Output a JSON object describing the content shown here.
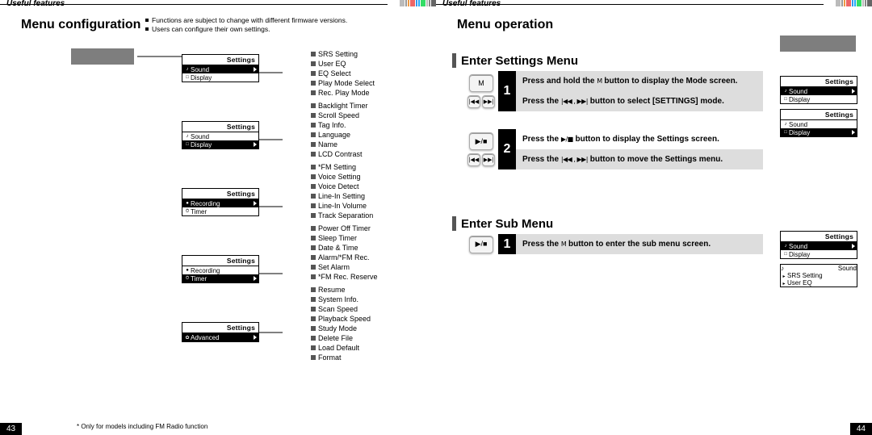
{
  "common": {
    "header_label": "Useful features",
    "settings_header": "Settings",
    "sound_header": "Sound"
  },
  "left_page": {
    "title": "Menu configuration",
    "notes": [
      "Functions are subject to change with different firmware versions.",
      "Users can configure their own settings."
    ],
    "footnote": "* Only for models including FM Radio function",
    "page_number": "43",
    "settings_column": [
      {
        "items": [
          {
            "icon": "♪",
            "label": "Sound",
            "sel": true
          },
          {
            "icon": "□",
            "label": "Display",
            "sel": false
          }
        ],
        "tree_idx": 0
      },
      {
        "items": [
          {
            "icon": "♪",
            "label": "Sound",
            "sel": false
          },
          {
            "icon": "□",
            "label": "Display",
            "sel": true
          }
        ],
        "tree_idx": 1
      },
      {
        "items": [
          {
            "icon": "●",
            "label": "Recording",
            "sel": true
          },
          {
            "icon": "⏱",
            "label": "Timer",
            "sel": false
          }
        ],
        "tree_idx": 2
      },
      {
        "items": [
          {
            "icon": "●",
            "label": "Recording",
            "sel": false
          },
          {
            "icon": "⏱",
            "label": "Timer",
            "sel": true
          }
        ],
        "tree_idx": 3
      },
      {
        "items": [
          {
            "icon": "✿",
            "label": "Advanced",
            "sel": true
          }
        ],
        "tree_idx": 4
      }
    ],
    "tree": [
      [
        "SRS Setting",
        "User EQ",
        "EQ Select",
        "Play Mode Select",
        "Rec. Play Mode"
      ],
      [
        "Backlight Timer",
        "Scroll Speed",
        "Tag Info.",
        "Language",
        "Name",
        "LCD Contrast"
      ],
      [
        "*FM Setting",
        "Voice Setting",
        "Voice Detect",
        "Line-In Setting",
        "Line-In Volume",
        "Track Separation"
      ],
      [
        "Power Off Timer",
        "Sleep Timer",
        "Date & Time",
        "Alarm/*FM Rec.",
        "Set Alarm",
        "*FM Rec. Reserve"
      ],
      [
        "Resume",
        "System Info.",
        "Scan Speed",
        "Playback Speed",
        "Study Mode",
        "Delete File",
        "Load Default",
        "Format"
      ]
    ]
  },
  "right_page": {
    "title": "Menu operation",
    "page_number": "44",
    "sections": [
      {
        "heading": "Enter Settings Menu",
        "steps": [
          {
            "num": "1",
            "keys": [
              [
                "M"
              ],
              [
                "|◀◀",
                "▶▶|"
              ]
            ],
            "lines": [
              {
                "t": "Press and hold the ",
                "sym": "M",
                "t2": " button to display the Mode screen.",
                "grey": true
              },
              {
                "t": "Press the ",
                "sym": "|◀◀ , ▶▶|",
                "t2": " button to select [SETTINGS] mode.",
                "grey": true
              }
            ]
          },
          {
            "num": "2",
            "keys": [
              [
                "▶/■"
              ],
              [
                "|◀◀",
                "▶▶|"
              ]
            ],
            "lines": [
              {
                "t": "Press the ",
                "sym": "▶/■",
                "t2": " button to display the Settings screen.",
                "grey": false
              },
              {
                "t": "Press the ",
                "sym": "|◀◀ , ▶▶|",
                "t2": " button to move the Settings menu.",
                "grey": true
              }
            ]
          }
        ],
        "rlcds": [
          {
            "type": "big_grey"
          },
          {
            "type": "settings",
            "items": [
              {
                "icon": "♪",
                "label": "Sound",
                "sel": true
              },
              {
                "icon": "□",
                "label": "Display",
                "sel": false
              }
            ]
          },
          {
            "type": "settings",
            "items": [
              {
                "icon": "♪",
                "label": "Sound",
                "sel": false
              },
              {
                "icon": "□",
                "label": "Display",
                "sel": true
              }
            ]
          }
        ]
      },
      {
        "heading": "Enter Sub Menu",
        "steps": [
          {
            "num": "1",
            "keys": [
              [
                "▶/■"
              ]
            ],
            "lines": [
              {
                "t": "Press the ",
                "sym": "M",
                "t2": " button to enter the sub menu screen.",
                "grey": true
              }
            ]
          }
        ],
        "rlcds": [
          {
            "type": "settings",
            "items": [
              {
                "icon": "♪",
                "label": "Sound",
                "sel": true
              },
              {
                "icon": "□",
                "label": "Display",
                "sel": false
              }
            ]
          },
          {
            "type": "sound_sub",
            "items": [
              {
                "icon": "▸",
                "label": "SRS Setting",
                "sel": true
              },
              {
                "icon": "▸",
                "label": "User EQ",
                "sel": false
              }
            ]
          }
        ]
      }
    ]
  },
  "stripe_colors": [
    "#bbb",
    "#999",
    "#e94",
    "#e66",
    "#39e",
    "#2af",
    "#3d6",
    "#bbb",
    "#888",
    "#666"
  ]
}
